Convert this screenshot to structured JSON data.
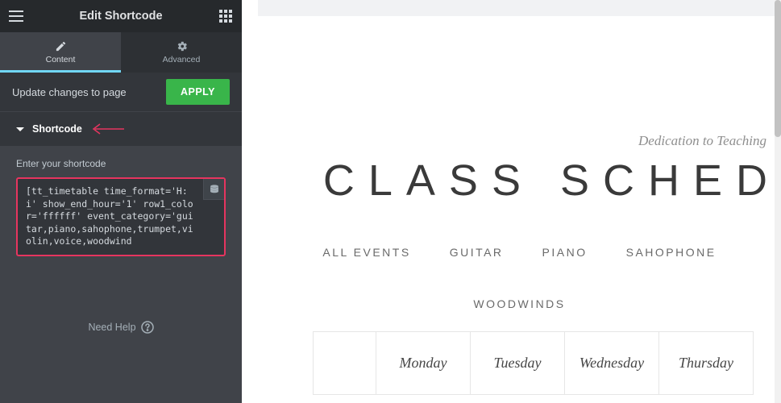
{
  "sidebar": {
    "title": "Edit Shortcode",
    "tabs": {
      "content": "Content",
      "advanced": "Advanced"
    },
    "update": {
      "text": "Update changes to page",
      "apply": "APPLY"
    },
    "section": {
      "title": "Shortcode"
    },
    "field": {
      "label": "Enter your shortcode",
      "value": "[tt_timetable time_format='H:i' show_end_hour='1' row1_color='ffffff' event_category='guitar,piano,sahophone,trumpet,violin,voice,woodwind"
    },
    "needHelp": "Need Help"
  },
  "preview": {
    "subtitle": "Dedication to Teaching",
    "title": "CLASS SCHED",
    "filters": [
      "ALL EVENTS",
      "GUITAR",
      "PIANO",
      "SAHOPHONE",
      "WOODWINDS"
    ],
    "days": [
      "Monday",
      "Tuesday",
      "Wednesday",
      "Thursday"
    ]
  }
}
